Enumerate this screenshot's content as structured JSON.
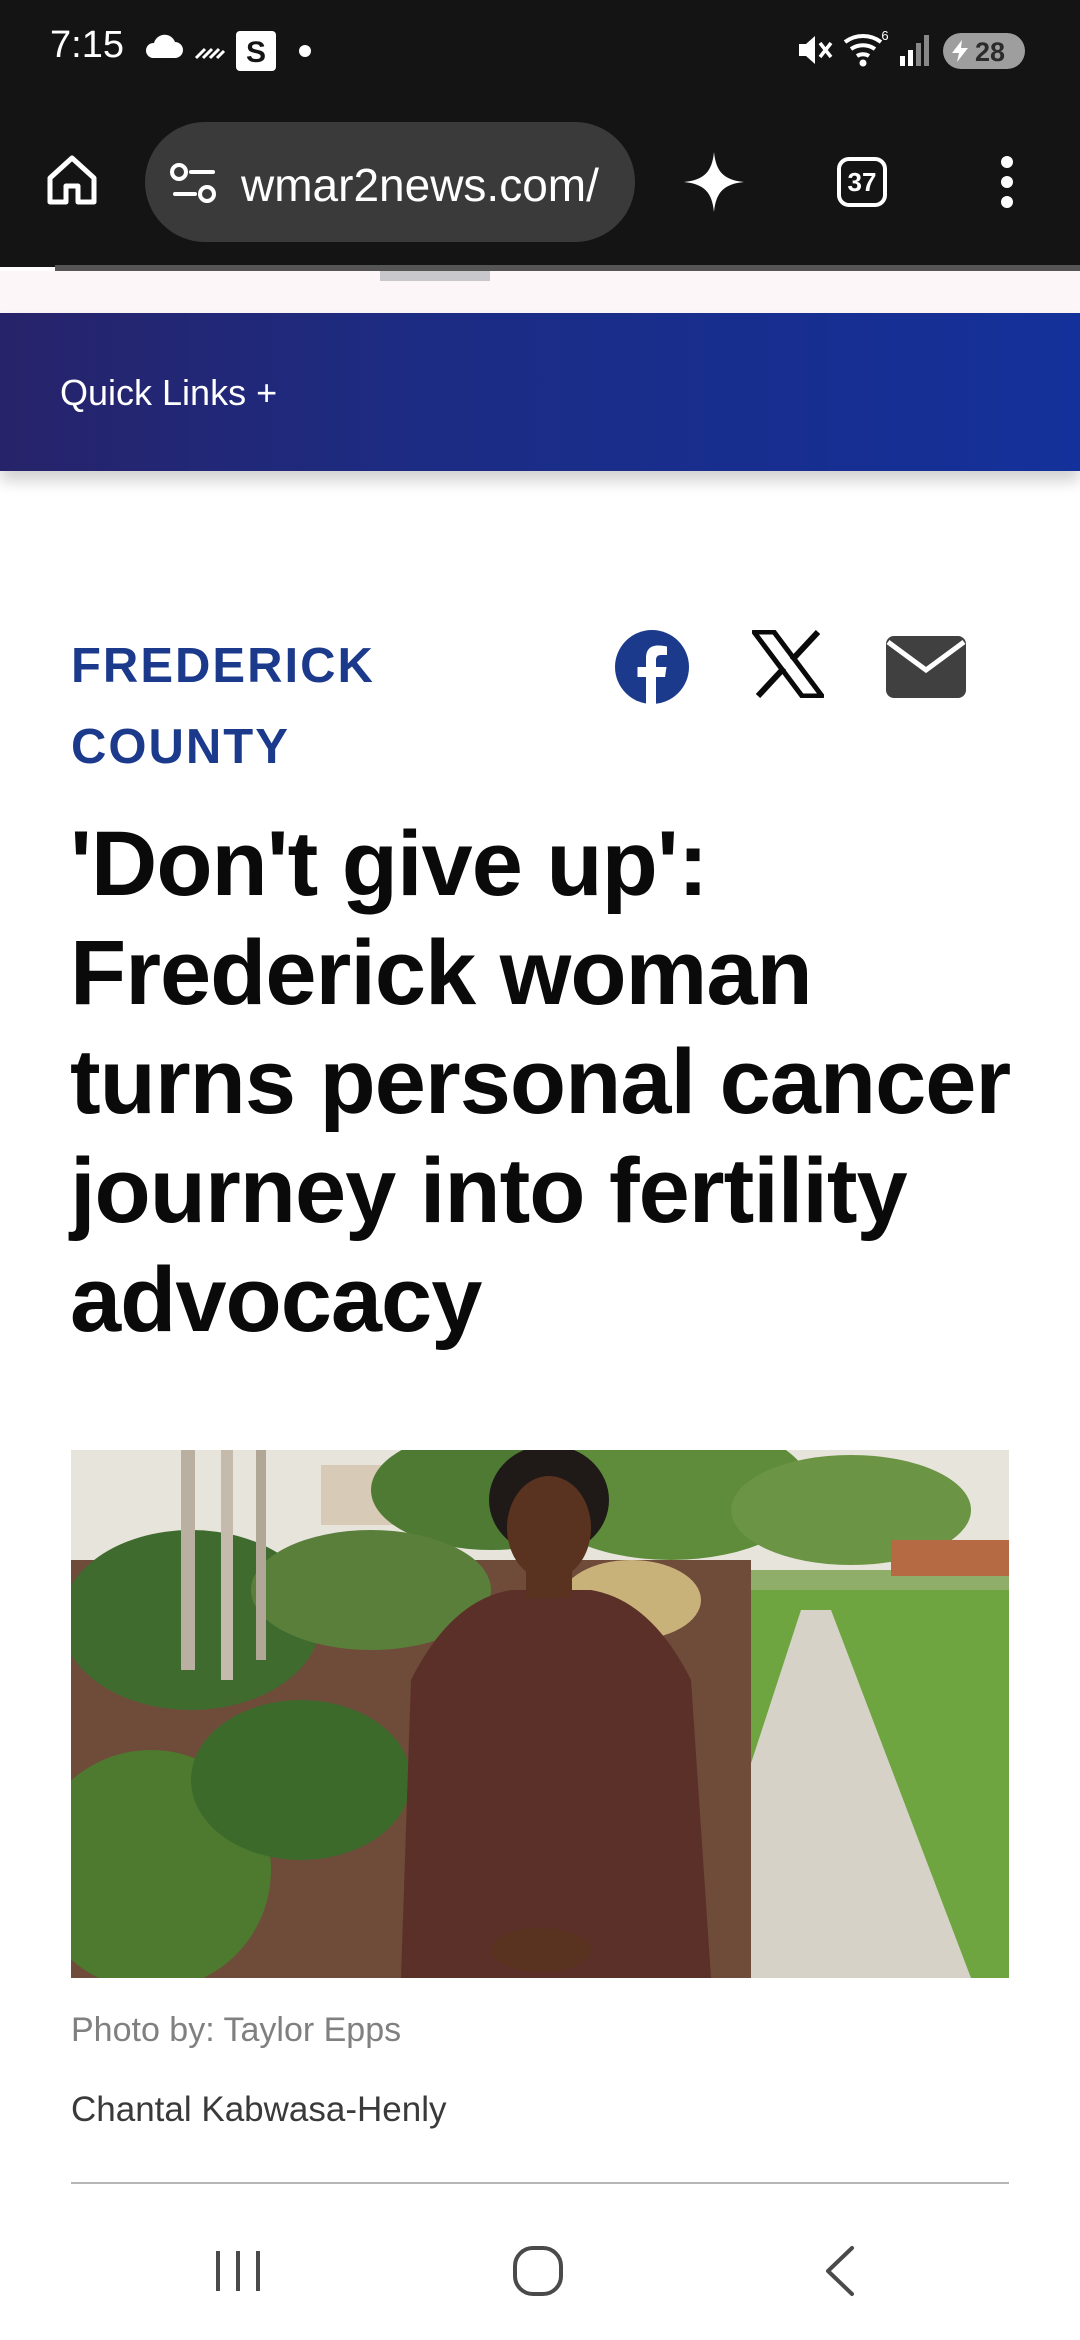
{
  "status_bar": {
    "time": "7:15",
    "battery": "28",
    "signal_badge": "6",
    "icons": [
      "cloud-icon",
      "missed-call-icon",
      "s-app-icon",
      "dot-icon",
      "mute-icon",
      "wifi-icon",
      "cell-signal-icon",
      "battery-charging-icon"
    ]
  },
  "browser": {
    "url": "wmar2news.com/",
    "tab_count": "37",
    "icons": [
      "home-icon",
      "site-settings-icon",
      "sparkle-icon",
      "tabs-icon",
      "more-vert-icon"
    ]
  },
  "site": {
    "quick_links": "Quick Links +",
    "brand_color": "#1c2c84"
  },
  "article": {
    "section": "FREDERICK COUNTY",
    "section_color": "#1c3a8c",
    "share_icons": [
      "facebook-icon",
      "x-icon",
      "email-icon"
    ],
    "headline": "'Don't give up': Frederick woman turns personal cancer journey into fertility advocacy",
    "photo_credit": "Photo by: Taylor Epps",
    "author": "Chantal Kabwasa-Henly"
  },
  "nav": {
    "icons": [
      "recent-apps-icon",
      "home-circle-icon",
      "back-icon"
    ]
  }
}
